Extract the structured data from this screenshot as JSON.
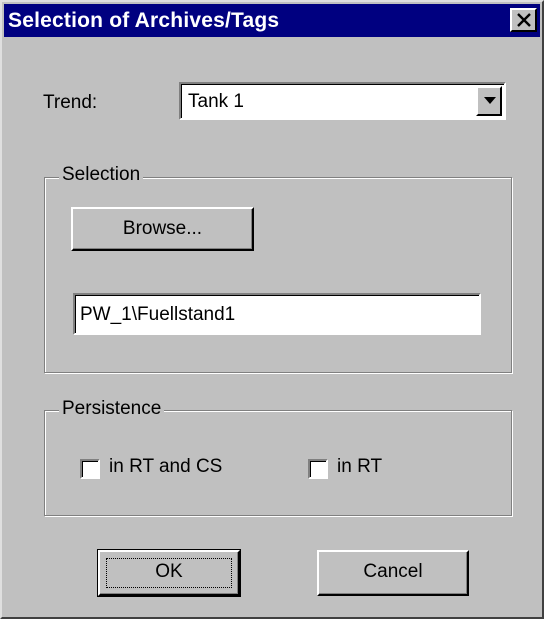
{
  "window": {
    "title": "Selection of Archives/Tags",
    "close_icon": "close-icon"
  },
  "trend": {
    "label": "Trend:",
    "value": "Tank 1",
    "dropdown_icon": "chevron-down-icon"
  },
  "selection": {
    "group_label": "Selection",
    "browse_label": "Browse...",
    "tag_value": "PW_1\\Fuellstand1"
  },
  "persistence": {
    "group_label": "Persistence",
    "options": [
      {
        "label": "in RT and CS",
        "checked": false
      },
      {
        "label": "in RT",
        "checked": false
      }
    ]
  },
  "buttons": {
    "ok_label": "OK",
    "cancel_label": "Cancel"
  },
  "colors": {
    "titlebar": "#000080",
    "face": "#c0c0c0"
  }
}
